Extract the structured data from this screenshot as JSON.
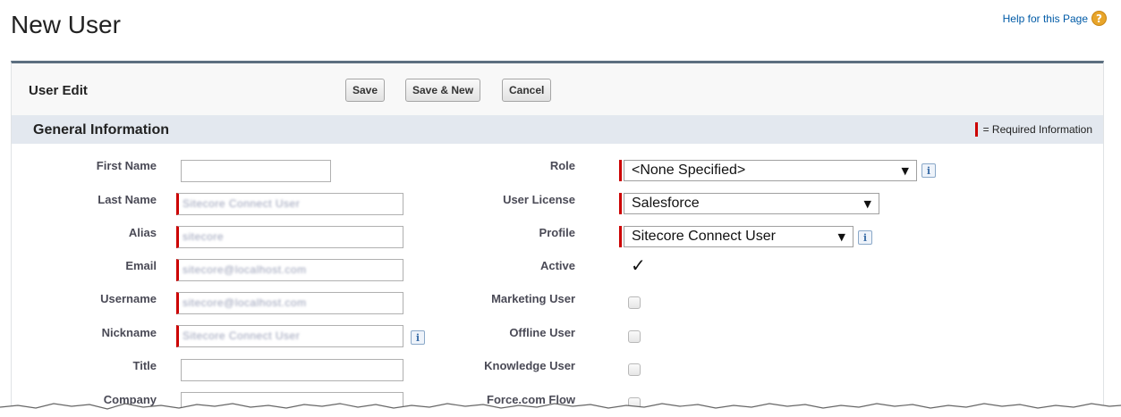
{
  "page": {
    "title": "New User",
    "help_link": "Help for this Page",
    "help_icon": "help-icon"
  },
  "panel": {
    "title": "User Edit",
    "buttons": {
      "save": "Save",
      "save_new": "Save & New",
      "cancel": "Cancel"
    }
  },
  "section": {
    "title": "General Information",
    "required_legend": "= Required Information"
  },
  "left_fields": {
    "first_name": {
      "label": "First Name",
      "value": ""
    },
    "last_name": {
      "label": "Last Name",
      "value": "Sitecore Connect User"
    },
    "alias": {
      "label": "Alias",
      "value": "sitecore"
    },
    "email": {
      "label": "Email",
      "value": "sitecore@localhost.com"
    },
    "username": {
      "label": "Username",
      "value": "sitecore@localhost.com"
    },
    "nickname": {
      "label": "Nickname",
      "value": "Sitecore Connect User"
    },
    "title": {
      "label": "Title",
      "value": ""
    },
    "company": {
      "label": "Company",
      "value": ""
    }
  },
  "right_fields": {
    "role": {
      "label": "Role",
      "value": "<None Specified>"
    },
    "user_license": {
      "label": "User License",
      "value": "Salesforce"
    },
    "profile": {
      "label": "Profile",
      "value": "Sitecore Connect User"
    },
    "active": {
      "label": "Active",
      "checked": true
    },
    "marketing_user": {
      "label": "Marketing User",
      "checked": false
    },
    "offline_user": {
      "label": "Offline User",
      "checked": false
    },
    "knowledge_user": {
      "label": "Knowledge User",
      "checked": false
    },
    "force_flow": {
      "label": "Force.com Flow",
      "checked": false
    }
  },
  "colors": {
    "required": "#cc0000",
    "panel_border": "#5c6f80",
    "section_bg": "#e3e8ef",
    "link": "#015ba7",
    "help_icon": "#e8a52a"
  }
}
